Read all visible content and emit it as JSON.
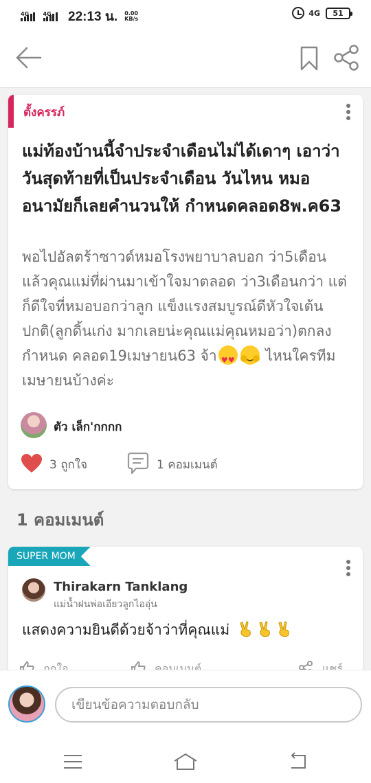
{
  "status_bar": {
    "signal_1": "4G",
    "signal_2": "4G",
    "time": "22:13 น.",
    "net_speed": "0.00",
    "net_unit": "KB/s",
    "network": "4G",
    "battery": "51"
  },
  "icons": {
    "back": "arrow-left-icon",
    "bookmark": "bookmark-icon",
    "share": "share-icon",
    "more": "more-vertical-icon",
    "like": "heart-icon",
    "comment": "comment-icon"
  },
  "colors": {
    "topic_accent": "#d6265e",
    "badge": "#19a6b9",
    "like": "#e04d4d"
  },
  "post": {
    "topic": "ตั้งครรภ์",
    "title": "แม่ท้องบ้านนี้จำประจำเดือนไม่ได้เดาๆ เอาว่าวันสุดท้ายที่เป็นประจำเดือน วันไหน หมอ อนามัยก็เลยคำนวนให้ กำหนดคลอด8พ.ค63",
    "body_1": "พอไปอัลตร้าซาวด์หมอโรงพยาบาลบอก ว่า5เดือนแล้วคุณแม่ที่ผ่านมาเข้าใจมาตลอด ว่า3เดือนกว่า  แต่ก็ดีใจที่หมอบอกว่าลูก แข็งแรงสมบูรณ์ดีหัวใจเต้นปกติ(ลูกดิ้นเก่ง มากเลยน่ะคุณแม่คุณหมอว่า)ตกลงกำหนด คลอด19เมษายน63 จ้า",
    "body_2": " ไหนใครทีม เมษายนบ้างค่ะ",
    "author": "ตัว เล็ก'กกกก",
    "likes": "3 ถูกใจ",
    "comments": "1 คอมเมนต์"
  },
  "comments_header": "1 คอมเมนต์",
  "comment": {
    "badge": "SUPER MOM",
    "name": "Thirakarn Tanklang",
    "subtitle": "แม่น้ำฝนพ่อเอียวลูกไออุ่น",
    "text": "แสดงความยินดีด้วยจ้าว่าที่คุณแม่",
    "action_like": "ถูกใจ",
    "action_comment": "คอมเมนต์",
    "action_share": "แชร์"
  },
  "reply": {
    "placeholder": "เขียนข้อความตอบกลับ"
  }
}
